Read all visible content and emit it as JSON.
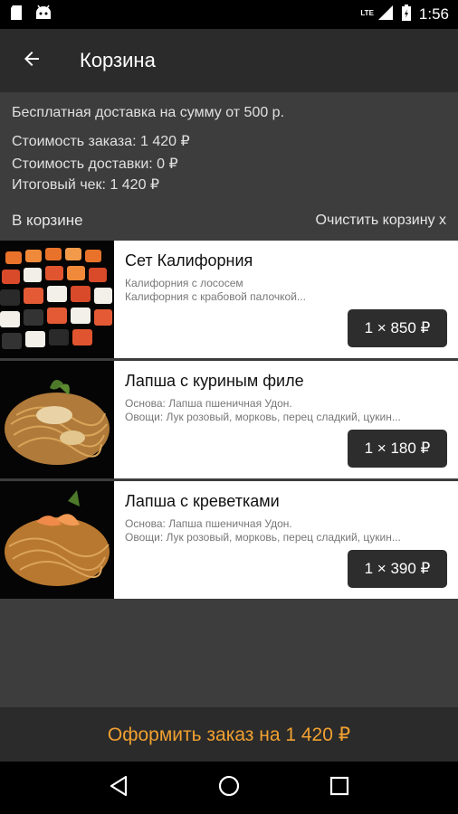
{
  "status_bar": {
    "time": "1:56",
    "network": "LTE"
  },
  "app_bar": {
    "title": "Корзина"
  },
  "summary": {
    "free_delivery": "Бесплатная доставка на сумму от 500 р.",
    "order_cost": "Стоимость заказа: 1 420 ₽",
    "delivery_cost": "Стоимость доставки: 0 ₽",
    "total": "Итоговый чек: 1 420 ₽"
  },
  "cart": {
    "heading": "В корзине",
    "clear_label": "Очистить корзину x",
    "items": [
      {
        "name": "Сет Калифорния",
        "desc1": "Калифорния с лососем",
        "desc2": "Калифорния с крабовой палочкой...",
        "price": "1 × 850 ₽"
      },
      {
        "name": "Лапша с куриным филе",
        "desc1": "Основа: Лапша пшеничная Удон.",
        "desc2": "Овощи: Лук розовый, морковь, перец сладкий, цукин...",
        "price": "1 × 180 ₽"
      },
      {
        "name": "Лапша с креветками",
        "desc1": "Основа: Лапша пшеничная Удон.",
        "desc2": "Овощи: Лук розовый, морковь, перец сладкий, цукин...",
        "price": "1 × 390 ₽"
      }
    ]
  },
  "checkout": {
    "label": "Оформить заказ на 1 420 ₽"
  },
  "colors": {
    "accent": "#f0a030",
    "app_bar": "#2b2b2b",
    "background": "#3d3d3d"
  }
}
